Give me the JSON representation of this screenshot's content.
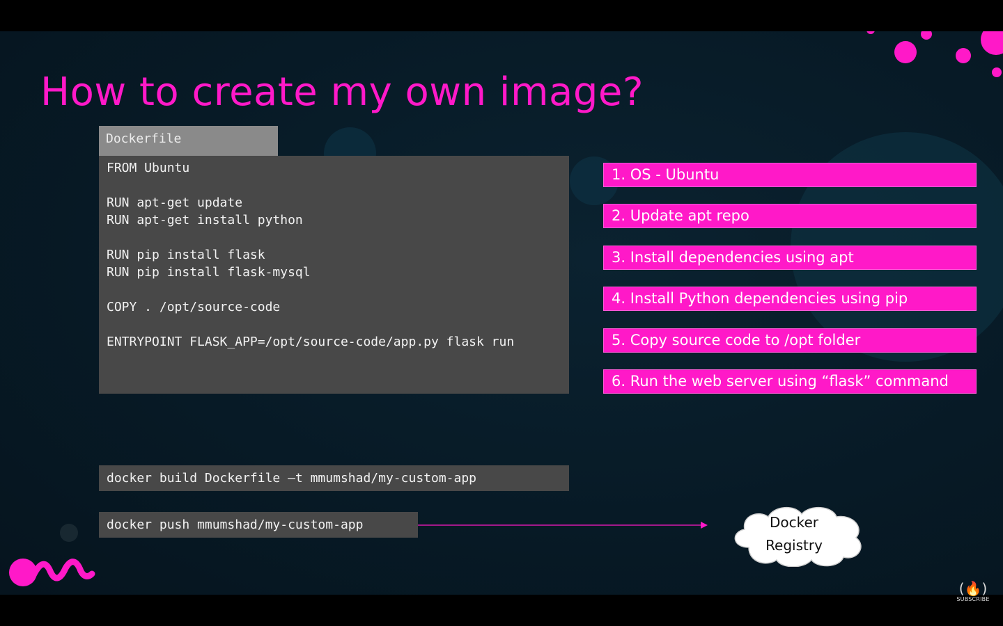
{
  "colors": {
    "accent": "#ff19c8",
    "title": "#ff19c8",
    "code_box": "#484848",
    "tab": "#8a8a8a",
    "background": "#071a26"
  },
  "slide": {
    "title": "How to create my own image?"
  },
  "dockerfile": {
    "tab_label": "Dockerfile",
    "lines": [
      "FROM Ubuntu",
      "",
      "RUN apt-get update",
      "RUN apt-get install python",
      "",
      "RUN pip install flask",
      "RUN pip install flask-mysql",
      "",
      "COPY . /opt/source-code",
      "",
      "ENTRYPOINT FLASK_APP=/opt/source-code/app.py flask run"
    ]
  },
  "steps": [
    "1. OS - Ubuntu",
    "2. Update apt repo",
    "3. Install dependencies using apt",
    "4. Install Python dependencies using pip",
    "5. Copy source code to /opt folder",
    "6. Run the web server using “flask” command"
  ],
  "commands": {
    "build": "docker build Dockerfile –t mmumshad/my-custom-app",
    "push": "docker push mmumshad/my-custom-app"
  },
  "registry": {
    "line1": "Docker",
    "line2": "Registry"
  },
  "logo": {
    "glyph": "(🔥)",
    "label": "SUBSCRIBE"
  }
}
